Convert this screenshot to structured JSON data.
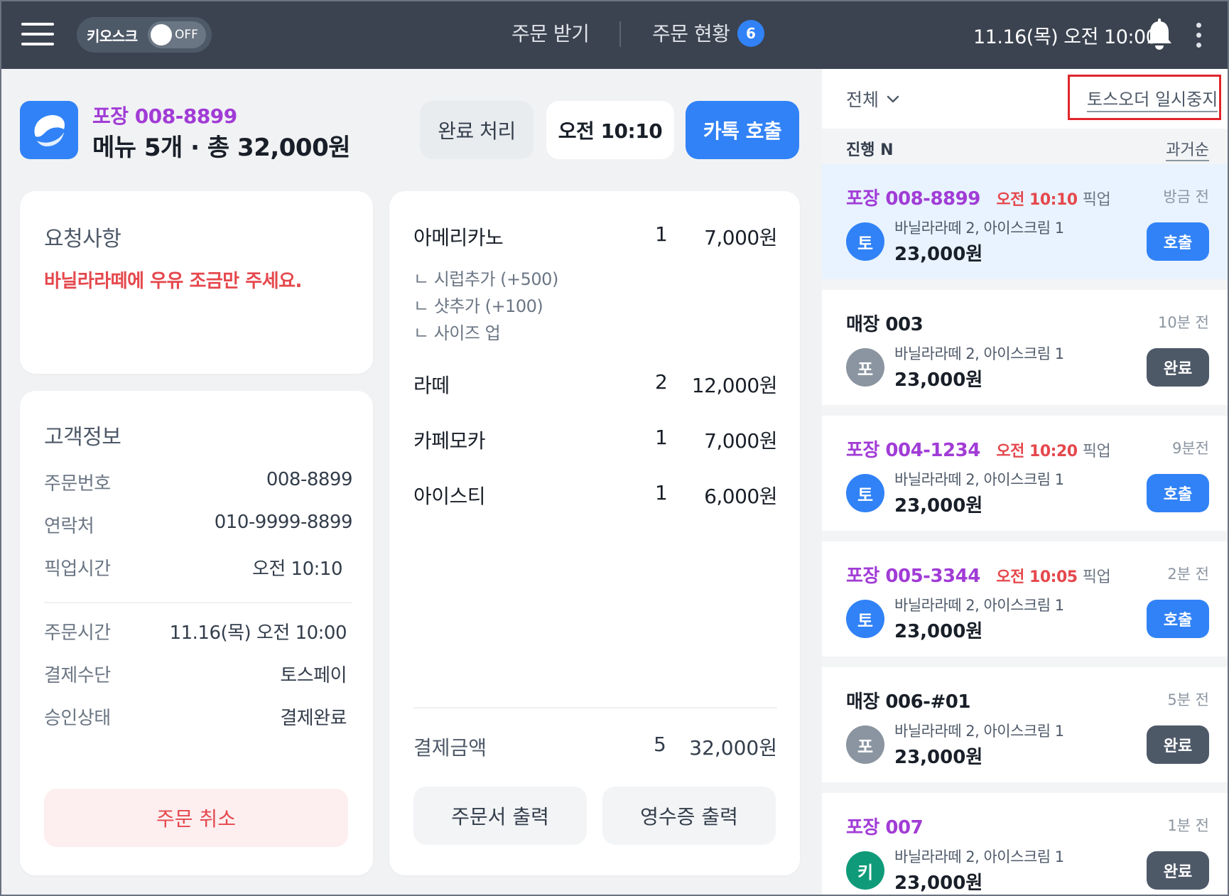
{
  "topbar": {
    "kiosk_label": "키오스크",
    "kiosk_toggle": "OFF",
    "tab_receive": "주문 받기",
    "tab_status": "주문 현황",
    "status_count": "6",
    "clock": "11.16(목) 오전 10:00"
  },
  "header": {
    "order_code": "포장 008-8899",
    "order_summary": "메뉴 5개 · 총 32,000원",
    "btn_complete": "완료 처리",
    "btn_time": "오전 10:10",
    "btn_kakao": "카톡 호출"
  },
  "request": {
    "title": "요청사항",
    "text": "바닐라라떼에 우유 조금만 주세요."
  },
  "customer": {
    "title": "고객정보",
    "rows": [
      {
        "k": "주문번호",
        "v": "008-8899"
      },
      {
        "k": "연락처",
        "v": "010-9999-8899"
      },
      {
        "k": "픽업시간",
        "v": "오전 10:10"
      },
      {
        "k": "주문시간",
        "v": "11.16(목) 오전 10:00"
      },
      {
        "k": "결제수단",
        "v": "토스페이"
      },
      {
        "k": "승인상태",
        "v": "결제완료"
      }
    ],
    "cancel": "주문 취소"
  },
  "menu": {
    "items": [
      {
        "name": "아메리카노",
        "qty": "1",
        "price": "7,000원"
      },
      {
        "name": "라떼",
        "qty": "2",
        "price": "12,000원"
      },
      {
        "name": "카페모카",
        "qty": "1",
        "price": "7,000원"
      },
      {
        "name": "아이스티",
        "qty": "1",
        "price": "6,000원"
      }
    ],
    "options": [
      "ㄴ 시럽추가 (+500)",
      "ㄴ 샷추가 (+100)",
      "ㄴ 사이즈 업"
    ],
    "total_label": "결제금액",
    "total_qty": "5",
    "total_price": "32,000원",
    "print_order": "주문서 출력",
    "print_receipt": "영수증 출력"
  },
  "panel": {
    "filter": "전체",
    "pause": "토스오더 일시중지",
    "progress": "진행 N",
    "past": "과거순",
    "orders": [
      {
        "type": "포장",
        "code": "008-8899",
        "time": "오전 10:10",
        "pickup": "픽업",
        "ago": "방금 전",
        "avatar": "토",
        "items": "바닐라라떼 2, 아이스크림 1",
        "price": "23,000원",
        "btn": "호출"
      },
      {
        "type": "매장",
        "code": "003",
        "time": "",
        "pickup": "",
        "ago": "10분 전",
        "avatar": "포",
        "items": "바닐라라떼 2, 아이스크림 1",
        "price": "23,000원",
        "btn": "완료"
      },
      {
        "type": "포장",
        "code": "004-1234",
        "time": "오전 10:20",
        "pickup": "픽업",
        "ago": "9분전",
        "avatar": "토",
        "items": "바닐라라떼 2, 아이스크림 1",
        "price": "23,000원",
        "btn": "호출"
      },
      {
        "type": "포장",
        "code": "005-3344",
        "time": "오전 10:05",
        "pickup": "픽업",
        "ago": "2분 전",
        "avatar": "토",
        "items": "바닐라라떼 2, 아이스크림 1",
        "price": "23,000원",
        "btn": "호출"
      },
      {
        "type": "매장",
        "code": "006-#01",
        "time": "",
        "pickup": "",
        "ago": "5분 전",
        "avatar": "포",
        "items": "바닐라라떼 2, 아이스크림 1",
        "price": "23,000원",
        "btn": "완료"
      },
      {
        "type": "포장",
        "code": "007",
        "time": "",
        "pickup": "",
        "ago": "1분 전",
        "avatar": "키",
        "items": "바닐라라떼 2, 아이스크림 1",
        "price": "23,000원",
        "btn": "완료"
      }
    ]
  },
  "colors": {
    "topbar": "#3b4350",
    "accent": "#3182f6",
    "takeout": "#a13cd6",
    "alert": "#e5484d",
    "done_button": "#4e5968",
    "avatar_toss": "#3182f6",
    "avatar_pos": "#8b95a1",
    "avatar_kiosk": "#0f9b7a"
  }
}
